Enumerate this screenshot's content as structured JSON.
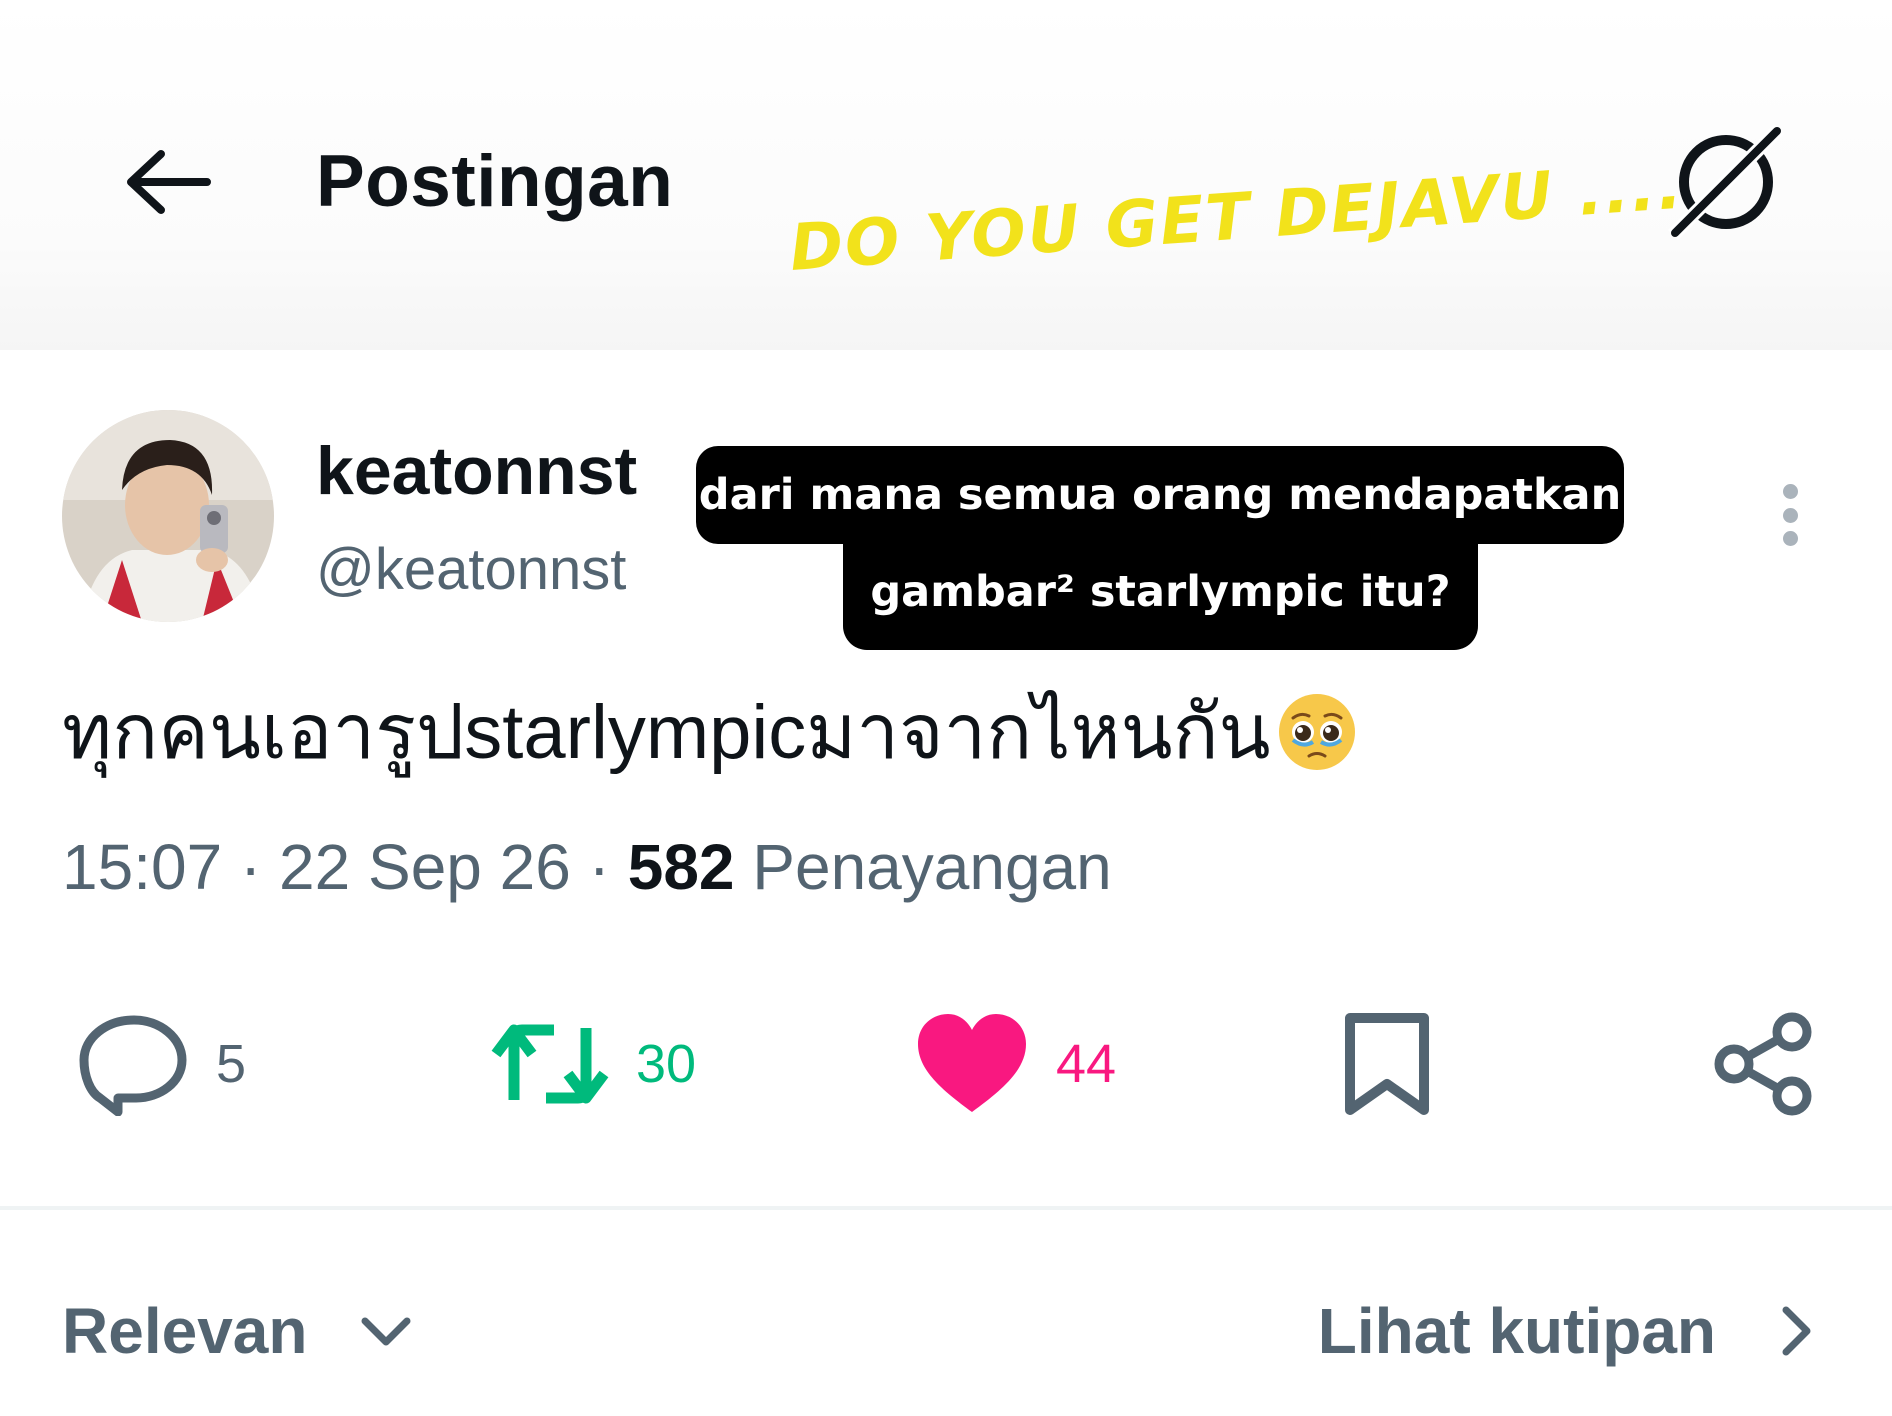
{
  "header": {
    "title": "Postingan",
    "back_icon": "arrow-left-icon",
    "grok_icon": "grok-icon"
  },
  "overlay": {
    "title": "DO YOU GET DEJAVU ....",
    "color": "#f2e21b",
    "caption_line1": "dari mana semua orang mendapatkan",
    "caption_line2": "gambar² starlympic itu?"
  },
  "post": {
    "author": {
      "display_name": "keatonnst",
      "handle": "@keatonnst"
    },
    "text": "ทุกคนเอารูปstarlympicมาจากไหนกัน",
    "emoji": "pleading-face",
    "time": "15:07",
    "date": "22 Sep 26",
    "views": "582",
    "views_label": "Penayangan",
    "actions": {
      "replies": "5",
      "retweets": "30",
      "likes": "44"
    },
    "liked": true
  },
  "footer": {
    "sort_label": "Relevan",
    "quotes_label": "Lihat kutipan"
  },
  "colors": {
    "text": "#0f1419",
    "secondary": "#536471",
    "retweet": "#00ba7c",
    "like": "#f91880"
  }
}
